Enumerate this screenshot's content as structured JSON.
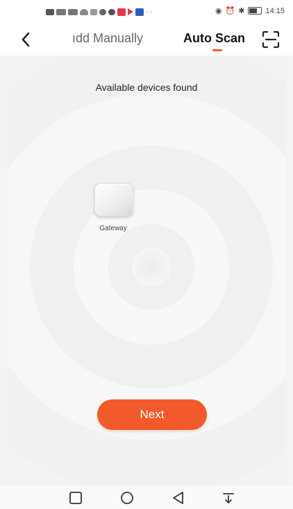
{
  "status_bar": {
    "time": "14:15",
    "icons": [
      "sim-icon",
      "signal-icon",
      "signal-icon",
      "wifi-icon",
      "network-speed-icon",
      "notification-icon",
      "chat-icon",
      "app-icon",
      "play-icon",
      "app-icon",
      "more-icon",
      "eye-icon",
      "alarm-icon",
      "bluetooth-icon",
      "battery-icon"
    ]
  },
  "header": {
    "back_icon": "chevron-left-icon",
    "tabs": [
      {
        "label": "ıdd Manually",
        "active": false
      },
      {
        "label": "Auto Scan",
        "active": true
      }
    ],
    "scan_icon": "scan-icon",
    "accent_color": "#ff5a26"
  },
  "main": {
    "status_text": "Available devices found",
    "devices": [
      {
        "name": "Gateway",
        "icon": "gateway-device-icon"
      }
    ],
    "next_button": "Next",
    "button_color": "#f25a2c"
  },
  "nav_bar": {
    "buttons": [
      "recent-apps-icon",
      "home-icon",
      "back-icon",
      "notification-pull-icon"
    ]
  }
}
